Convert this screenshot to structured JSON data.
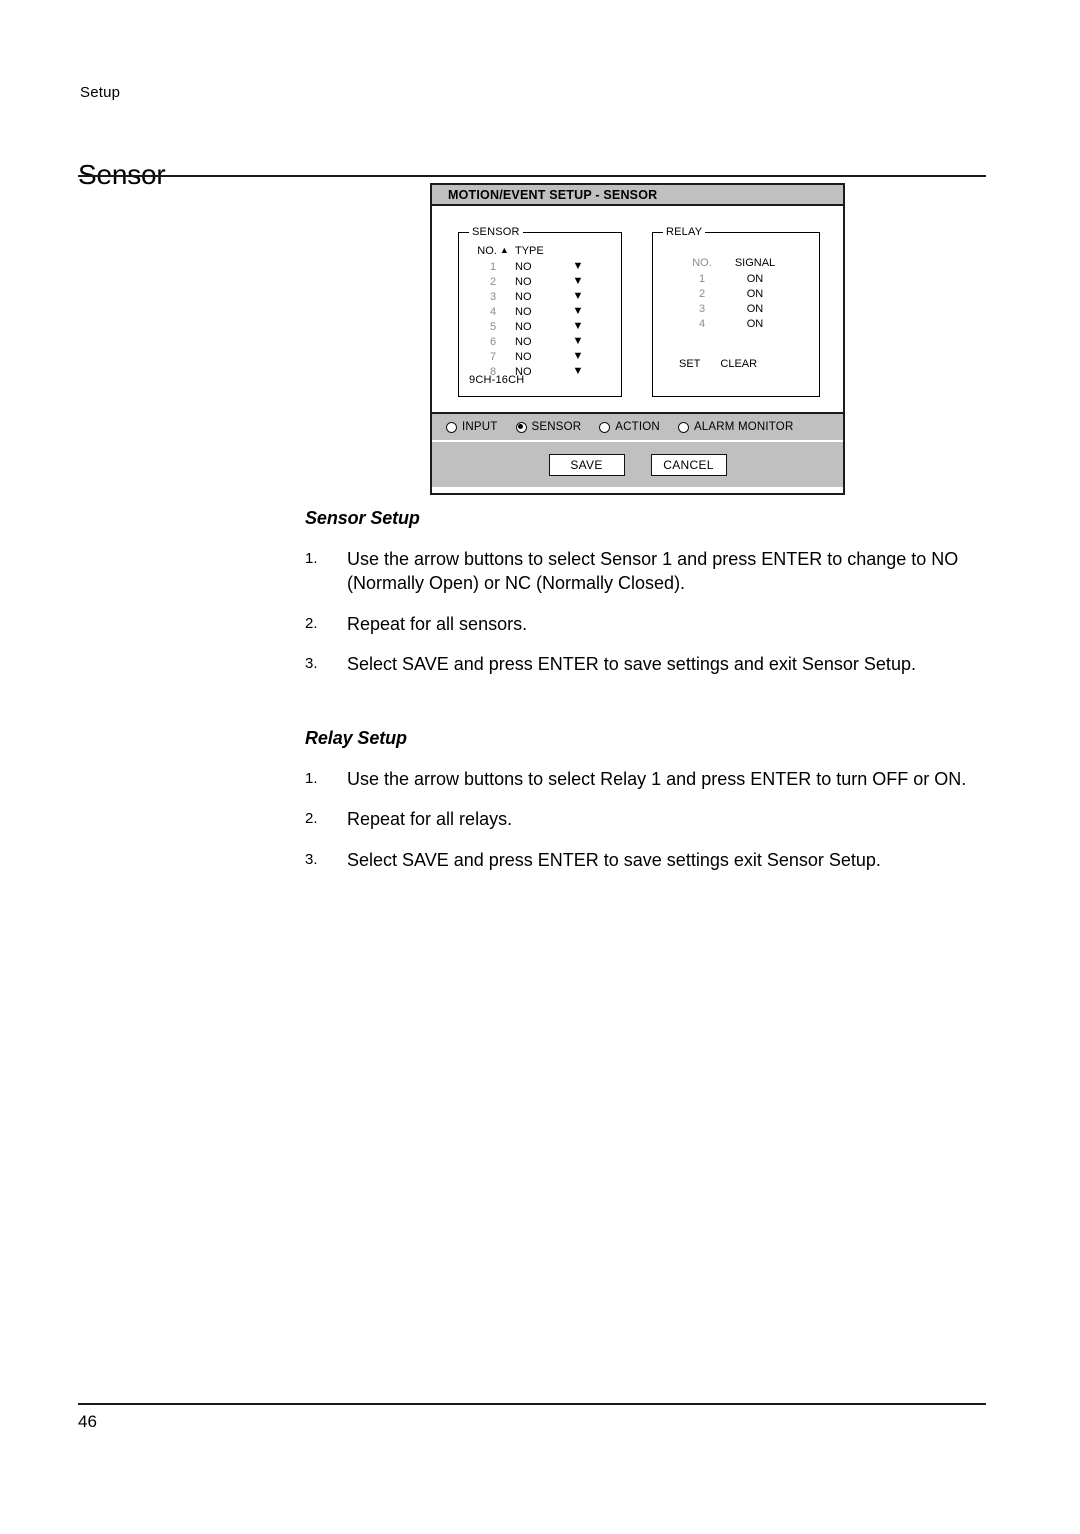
{
  "page": {
    "running_head": "Setup",
    "title": "Sensor",
    "number": "46"
  },
  "dialog": {
    "title": "MOTION/EVENT SETUP - SENSOR",
    "sensor_group": {
      "legend": "SENSOR",
      "columns": [
        "NO.",
        "TYPE"
      ],
      "sort_arrow": "▲",
      "row_arrow": "▼",
      "rows": [
        {
          "no": "1",
          "type": "NO"
        },
        {
          "no": "2",
          "type": "NO"
        },
        {
          "no": "3",
          "type": "NO"
        },
        {
          "no": "4",
          "type": "NO"
        },
        {
          "no": "5",
          "type": "NO"
        },
        {
          "no": "6",
          "type": "NO"
        },
        {
          "no": "7",
          "type": "NO"
        },
        {
          "no": "8",
          "type": "NO"
        }
      ],
      "channel_note": "9CH-16CH"
    },
    "relay_group": {
      "legend": "RELAY",
      "columns": [
        "NO.",
        "SIGNAL"
      ],
      "rows": [
        {
          "no": "1",
          "signal": "ON"
        },
        {
          "no": "2",
          "signal": "ON"
        },
        {
          "no": "3",
          "signal": "ON"
        },
        {
          "no": "4",
          "signal": "ON"
        }
      ],
      "set_label": "SET",
      "clear_label": "CLEAR"
    },
    "radios": [
      {
        "label": "INPUT",
        "selected": false
      },
      {
        "label": "SENSOR",
        "selected": true
      },
      {
        "label": "ACTION",
        "selected": false
      },
      {
        "label": "ALARM MONITOR",
        "selected": false
      }
    ],
    "buttons": {
      "save": "SAVE",
      "cancel": "CANCEL"
    },
    "colors": {
      "chrome_gray": "#c0c0c0",
      "border": "#1b1b1b",
      "muted_text": "#8c8c8c"
    }
  },
  "sensor_setup": {
    "heading": "Sensor Setup",
    "steps": [
      {
        "num": "1.",
        "text": "Use the arrow buttons to select Sensor 1 and press ENTER to change to NO (Normally Open) or NC (Normally Closed)."
      },
      {
        "num": "2.",
        "text": "Repeat for all sensors."
      },
      {
        "num": "3.",
        "text": "Select SAVE and press ENTER to save settings and exit Sensor Setup."
      }
    ]
  },
  "relay_setup": {
    "heading": "Relay Setup",
    "steps": [
      {
        "num": "1.",
        "text": "Use the arrow buttons to select Relay 1 and press ENTER to turn OFF or ON."
      },
      {
        "num": "2.",
        "text": "Repeat for all relays."
      },
      {
        "num": "3.",
        "text": "Select SAVE and press ENTER to save settings exit Sensor Setup."
      }
    ]
  }
}
